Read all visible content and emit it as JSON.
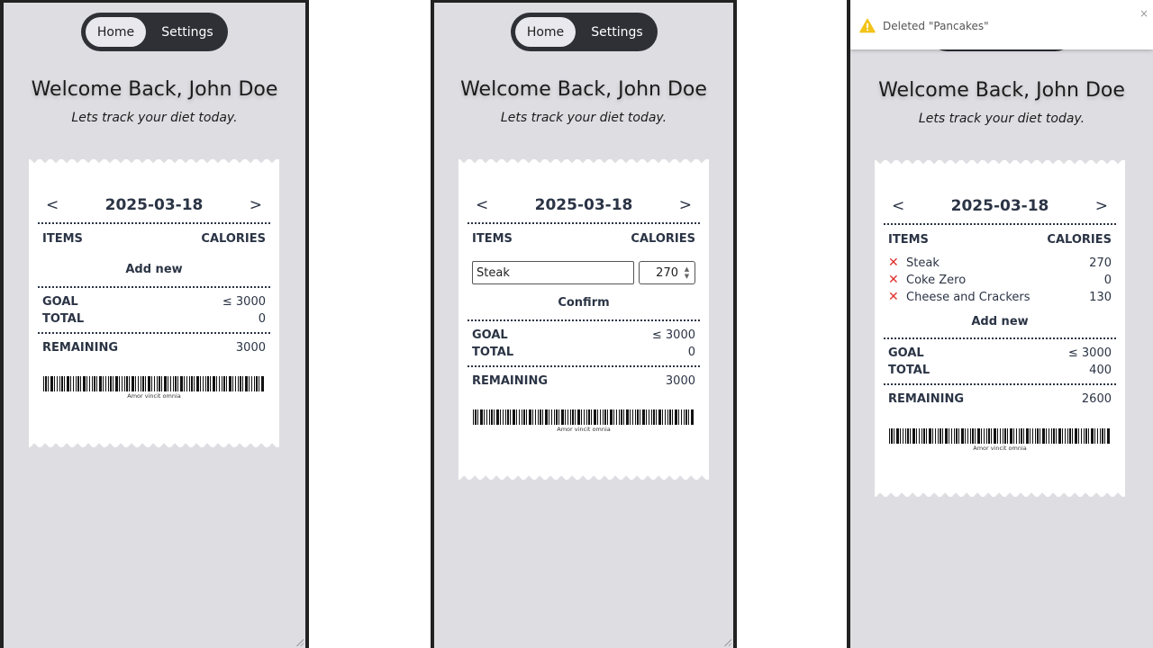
{
  "nav": {
    "home_label": "Home",
    "settings_label": "Settings"
  },
  "header": {
    "welcome": "Welcome Back, John Doe",
    "tagline": "Lets track your diet today."
  },
  "receipt": {
    "date": "2025-03-18",
    "prev": "<",
    "next": ">",
    "items_header": "ITEMS",
    "calories_header": "CALORIES",
    "add_new": "Add new",
    "confirm": "Confirm",
    "goal_label": "GOAL",
    "total_label": "TOTAL",
    "remaining_label": "REMAINING",
    "motto": "Amor vincit omnia"
  },
  "screen1": {
    "goal": "≤ 3000",
    "total": "0",
    "remaining": "3000"
  },
  "screen2": {
    "name_value": "Steak",
    "calorie_value": "270",
    "goal": "≤ 3000",
    "total": "0",
    "remaining": "3000"
  },
  "screen3": {
    "items": [
      {
        "name": "Steak",
        "calories": "270",
        "delete": "✕"
      },
      {
        "name": "Coke Zero",
        "calories": "0",
        "delete": "✕"
      },
      {
        "name": "Cheese and Crackers",
        "calories": "130",
        "delete": "✕"
      }
    ],
    "goal": "≤ 3000",
    "total": "400",
    "remaining": "2600"
  },
  "toast": {
    "message": "Deleted \"Pancakes\"",
    "close": "×",
    "icon": "warning-icon",
    "icon_color": "#f2c318"
  },
  "colors": {
    "background": "#dedde2",
    "nav": "#2e3036",
    "delete": "#e0312e"
  }
}
